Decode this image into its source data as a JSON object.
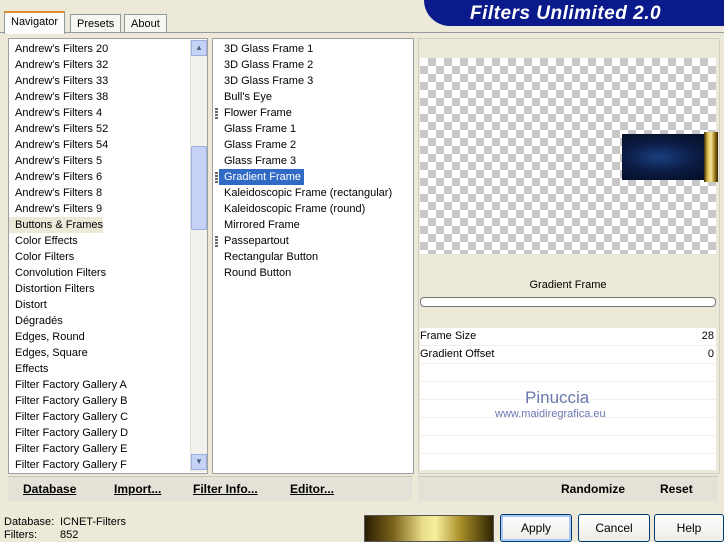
{
  "tabs": [
    "Navigator",
    "Presets",
    "About"
  ],
  "banner_title": "Filters Unlimited 2.0",
  "categories": [
    "Andrew's Filters 20",
    "Andrew's Filters 32",
    "Andrew's Filters 33",
    "Andrew's Filters 38",
    "Andrew's Filters 4",
    "Andrew's Filters 52",
    "Andrew's Filters 54",
    "Andrew's Filters 5",
    "Andrew's Filters 6",
    "Andrew's Filters 8",
    "Andrew's Filters 9",
    "Buttons & Frames",
    "Color Effects",
    "Color Filters",
    "Convolution Filters",
    "Distortion Filters",
    "Distort",
    "Dégradés",
    "Edges, Round",
    "Edges, Square",
    "Effects",
    "Filter Factory Gallery A",
    "Filter Factory Gallery B",
    "Filter Factory Gallery C",
    "Filter Factory Gallery D",
    "Filter Factory Gallery E",
    "Filter Factory Gallery F"
  ],
  "highlighted_category": "Buttons & Frames",
  "filters": [
    "3D Glass Frame 1",
    "3D Glass Frame 2",
    "3D Glass Frame 3",
    "Bull's Eye",
    "Flower Frame",
    "Glass Frame 1",
    "Glass Frame 2",
    "Glass Frame 3",
    "Gradient Frame",
    "Kaleidoscopic Frame (rectangular)",
    "Kaleidoscopic Frame (round)",
    "Mirrored Frame",
    "Passepartout",
    "Rectangular Button",
    "Round Button"
  ],
  "filters_with_icon": [
    "Flower Frame",
    "Gradient Frame",
    "Passepartout"
  ],
  "selected_filter": "Gradient Frame",
  "preview": {
    "filter_name": "Gradient Frame",
    "params": [
      {
        "label": "Frame Size",
        "value": "28"
      },
      {
        "label": "Gradient Offset",
        "value": "0"
      }
    ]
  },
  "watermark": {
    "line1": "Pinuccia",
    "line2": "www.maidiregrafica.eu"
  },
  "bottom_left_buttons": [
    "Database",
    "Import...",
    "Filter Info...",
    "Editor..."
  ],
  "bottom_right_buttons": [
    "Randomize",
    "Reset"
  ],
  "status": {
    "database_label": "Database:",
    "database_value": "ICNET-Filters",
    "filters_label": "Filters:",
    "filters_value": "852"
  },
  "dialog_buttons": {
    "apply": "Apply",
    "cancel": "Cancel",
    "help": "Help"
  },
  "colors": {
    "selection": "#316ac5",
    "banner": "#0a1a8a",
    "window": "#ece9d8"
  },
  "icons": [
    "scroll-up-icon",
    "scroll-down-icon",
    "filter-type-icon"
  ]
}
